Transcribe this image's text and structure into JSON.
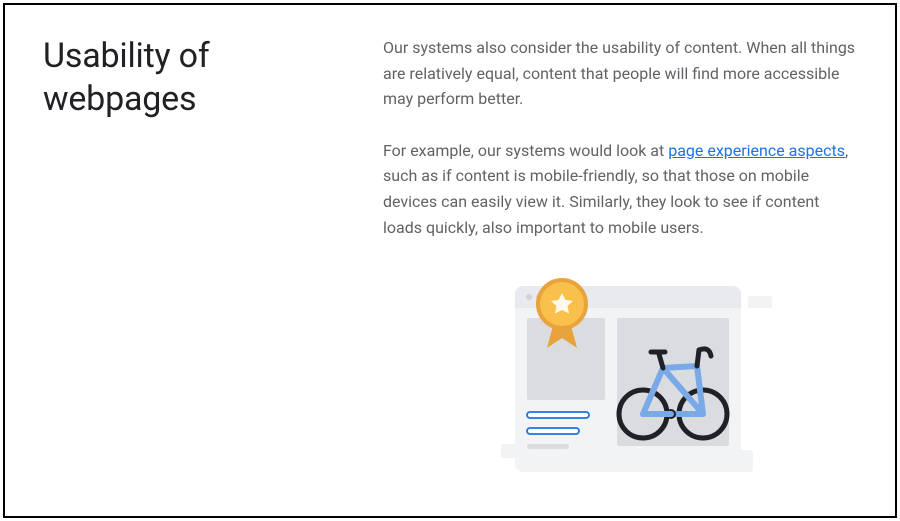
{
  "heading": "Usability of webpages",
  "para1": "Our systems also consider the usability of content. When all things are relatively equal, content that people will find more accessible may perform better.",
  "para2_before": "For example, our systems would look at ",
  "para2_link": "page experience aspects",
  "para2_after": ", such as if content is mobile-friendly, so that those on mobile devices can easily view it. Similarly, they look to see if content loads quickly, also important to mobile users."
}
